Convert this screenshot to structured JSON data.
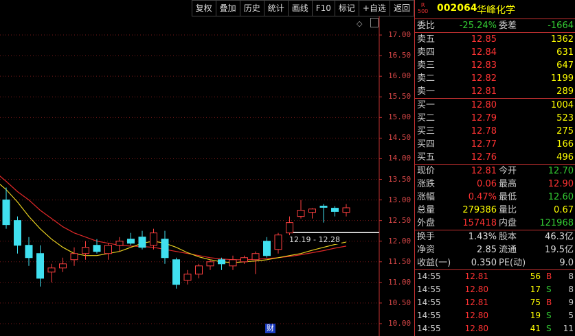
{
  "toolbar": [
    "复权",
    "叠加",
    "历史",
    "统计",
    "画线",
    "F10",
    "标记",
    "+自选",
    "返回"
  ],
  "stock": {
    "badge_top": "R",
    "badge_bottom": "500",
    "code": "002064",
    "name": "华峰化学"
  },
  "ratio": {
    "wb_label": "委比",
    "wb_value": "-25.24%",
    "wc_label": "委差",
    "wc_value": "-1664"
  },
  "asks": [
    {
      "label": "卖五",
      "price": "12.85",
      "qty": "1362"
    },
    {
      "label": "卖四",
      "price": "12.84",
      "qty": "631"
    },
    {
      "label": "卖三",
      "price": "12.83",
      "qty": "647"
    },
    {
      "label": "卖二",
      "price": "12.82",
      "qty": "1199"
    },
    {
      "label": "卖一",
      "price": "12.81",
      "qty": "289"
    }
  ],
  "bids": [
    {
      "label": "买一",
      "price": "12.80",
      "qty": "1004"
    },
    {
      "label": "买二",
      "price": "12.79",
      "qty": "523"
    },
    {
      "label": "买三",
      "price": "12.78",
      "qty": "275"
    },
    {
      "label": "买四",
      "price": "12.77",
      "qty": "166"
    },
    {
      "label": "买五",
      "price": "12.76",
      "qty": "496"
    }
  ],
  "quote": [
    {
      "l1": "现价",
      "v1": "12.81",
      "l2": "今开",
      "v2": "12.70"
    },
    {
      "l1": "涨跌",
      "v1": "0.06",
      "l2": "最高",
      "v2": "12.90"
    },
    {
      "l1": "涨幅",
      "v1": "0.47%",
      "l2": "最低",
      "v2": "12.60"
    },
    {
      "l1": "总量",
      "v1": "279386",
      "l2": "量比",
      "v2": "0.67"
    },
    {
      "l1": "外盘",
      "v1": "157418",
      "l2": "内盘",
      "v2": "121968"
    }
  ],
  "fundamentals": [
    {
      "l1": "换手",
      "v1": "1.43%",
      "l2": "股本",
      "v2": "46.3亿"
    },
    {
      "l1": "净资",
      "v1": "2.85",
      "l2": "流通",
      "v2": "19.5亿"
    },
    {
      "l1": "收益(一)",
      "v1": "0.350",
      "l2": "PE(动)",
      "v2": "9.0"
    }
  ],
  "ticks": [
    {
      "time": "14:55",
      "price": "12.81",
      "vol": "56",
      "dir": "B",
      "n": "8"
    },
    {
      "time": "14:55",
      "price": "12.80",
      "vol": "17",
      "dir": "S",
      "n": "8"
    },
    {
      "time": "14:55",
      "price": "12.81",
      "vol": "75",
      "dir": "B",
      "n": "9"
    },
    {
      "time": "14:55",
      "price": "12.80",
      "vol": "19",
      "dir": "S",
      "n": "5"
    },
    {
      "time": "14:55",
      "price": "12.80",
      "vol": "41",
      "dir": "S",
      "n": "11"
    }
  ],
  "chart_data": {
    "type": "candlestick",
    "y_ticks": [
      "17.00",
      "16.50",
      "16.00",
      "15.50",
      "15.00",
      "14.50",
      "14.00",
      "13.50",
      "13.00",
      "12.50",
      "12.00",
      "11.50",
      "11.00",
      "10.50",
      "10.00"
    ],
    "ylim": [
      9.7,
      17.45
    ],
    "range_label": "12.19 - 12.28",
    "marker_label": "财",
    "up_color": "#ff4040",
    "down_color": "#40e0f0",
    "candles": [
      {
        "o": 13.0,
        "h": 13.3,
        "l": 12.3,
        "c": 12.4
      },
      {
        "o": 12.5,
        "h": 12.6,
        "l": 11.7,
        "c": 11.9
      },
      {
        "o": 11.9,
        "h": 12.1,
        "l": 11.4,
        "c": 11.6
      },
      {
        "o": 11.7,
        "h": 11.9,
        "l": 10.9,
        "c": 11.1
      },
      {
        "o": 11.25,
        "h": 11.45,
        "l": 11.0,
        "c": 11.35
      },
      {
        "o": 11.35,
        "h": 11.6,
        "l": 11.25,
        "c": 11.45
      },
      {
        "o": 11.55,
        "h": 11.85,
        "l": 11.4,
        "c": 11.7
      },
      {
        "o": 11.7,
        "h": 12.0,
        "l": 11.55,
        "c": 11.85
      },
      {
        "o": 11.9,
        "h": 12.05,
        "l": 11.7,
        "c": 11.75
      },
      {
        "o": 11.7,
        "h": 11.95,
        "l": 11.55,
        "c": 11.9
      },
      {
        "o": 11.9,
        "h": 12.1,
        "l": 11.75,
        "c": 12.0
      },
      {
        "o": 12.05,
        "h": 12.2,
        "l": 11.9,
        "c": 11.95
      },
      {
        "o": 12.1,
        "h": 12.25,
        "l": 11.8,
        "c": 11.85
      },
      {
        "o": 11.9,
        "h": 12.3,
        "l": 11.8,
        "c": 12.2
      },
      {
        "o": 12.05,
        "h": 12.25,
        "l": 11.45,
        "c": 11.6
      },
      {
        "o": 11.55,
        "h": 11.6,
        "l": 10.85,
        "c": 10.95
      },
      {
        "o": 11.05,
        "h": 11.3,
        "l": 10.95,
        "c": 11.2
      },
      {
        "o": 11.2,
        "h": 11.45,
        "l": 11.1,
        "c": 11.4
      },
      {
        "o": 11.4,
        "h": 11.55,
        "l": 11.3,
        "c": 11.5
      },
      {
        "o": 11.55,
        "h": 11.6,
        "l": 11.3,
        "c": 11.45
      },
      {
        "o": 11.4,
        "h": 11.65,
        "l": 11.3,
        "c": 11.55
      },
      {
        "o": 11.5,
        "h": 11.65,
        "l": 11.45,
        "c": 11.6
      },
      {
        "o": 11.55,
        "h": 11.75,
        "l": 11.2,
        "c": 11.7
      },
      {
        "o": 12.0,
        "h": 12.1,
        "l": 11.6,
        "c": 11.65
      },
      {
        "o": 11.8,
        "h": 12.2,
        "l": 11.7,
        "c": 12.15
      },
      {
        "o": 12.2,
        "h": 12.6,
        "l": 12.1,
        "c": 12.45
      },
      {
        "o": 12.6,
        "h": 13.0,
        "l": 12.55,
        "c": 12.75
      },
      {
        "o": 12.7,
        "h": 12.8,
        "l": 12.55,
        "c": 12.78
      },
      {
        "o": 12.85,
        "h": 12.9,
        "l": 12.45,
        "c": 12.82
      },
      {
        "o": 12.8,
        "h": 12.85,
        "l": 12.6,
        "c": 12.72
      },
      {
        "o": 12.7,
        "h": 12.9,
        "l": 12.6,
        "c": 12.81
      }
    ],
    "ma_red": [
      13.45,
      13.2,
      13.0,
      12.75,
      12.55,
      12.35,
      12.2,
      12.1,
      12.0,
      11.95,
      11.9,
      11.88,
      11.87,
      11.85,
      11.8,
      11.75,
      11.7,
      11.65,
      11.6,
      11.57,
      11.55,
      11.55,
      11.56,
      11.58,
      11.6,
      11.63,
      11.67,
      11.72,
      11.77,
      11.83,
      11.88
    ],
    "ma_yellow": [
      13.25,
      12.95,
      12.6,
      12.3,
      12.05,
      11.85,
      11.7,
      11.65,
      11.65,
      11.7,
      11.75,
      11.85,
      11.95,
      12.0,
      11.95,
      11.85,
      11.72,
      11.62,
      11.55,
      11.5,
      11.48,
      11.5,
      11.52,
      11.55,
      11.6,
      11.65,
      11.7,
      11.78,
      11.85,
      11.92,
      11.98
    ]
  }
}
